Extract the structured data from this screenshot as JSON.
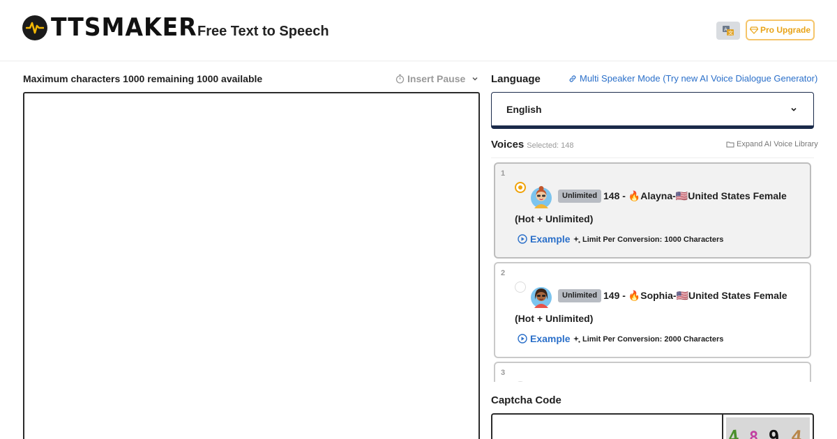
{
  "header": {
    "logo_text": "TTSMAKER",
    "tagline": "Free Text to Speech",
    "pro_upgrade_label": "Pro Upgrade",
    "pro_icon": "diamond-icon",
    "translate_icon": "translate-icon"
  },
  "editor": {
    "char_info": "Maximum characters 1000 remaining 1000 available",
    "insert_pause_label": "Insert Pause",
    "text_value": ""
  },
  "language": {
    "label": "Language",
    "multi_speaker_link": "Multi Speaker Mode (Try new AI Voice Dialogue Generator)",
    "selected": "English"
  },
  "voices": {
    "label": "Voices",
    "selected_count": "Selected: 148",
    "expand_link": "Expand AI Voice Library",
    "items": [
      {
        "index": "1",
        "badge": "Unlimited",
        "title_line1": "148 - 🔥Alayna-🇺🇸United States Female",
        "title_line2": "(Hot + Unlimited)",
        "example_label": "Example",
        "limit": "Limit Per Conversion: 1000 Characters",
        "selected": true
      },
      {
        "index": "2",
        "badge": "Unlimited",
        "title_line1": "149 - 🔥Sophia-🇺🇸United States Female",
        "title_line2": "(Hot + Unlimited)",
        "example_label": "Example",
        "limit": "Limit Per Conversion: 2000 Characters",
        "selected": false
      },
      {
        "index": "3"
      }
    ]
  },
  "captcha": {
    "label": "Captcha Code",
    "value": "",
    "chars": [
      "4",
      "8",
      "9",
      "4"
    ],
    "colors": [
      "#4a8f2a",
      "#c23fa0",
      "#111111",
      "#b8864a"
    ]
  },
  "colors": {
    "accent_blue": "#2a6fc9",
    "pro_orange": "#e8a317",
    "radio_orange": "#f0a30a",
    "select_border": "#1a2a4a"
  }
}
